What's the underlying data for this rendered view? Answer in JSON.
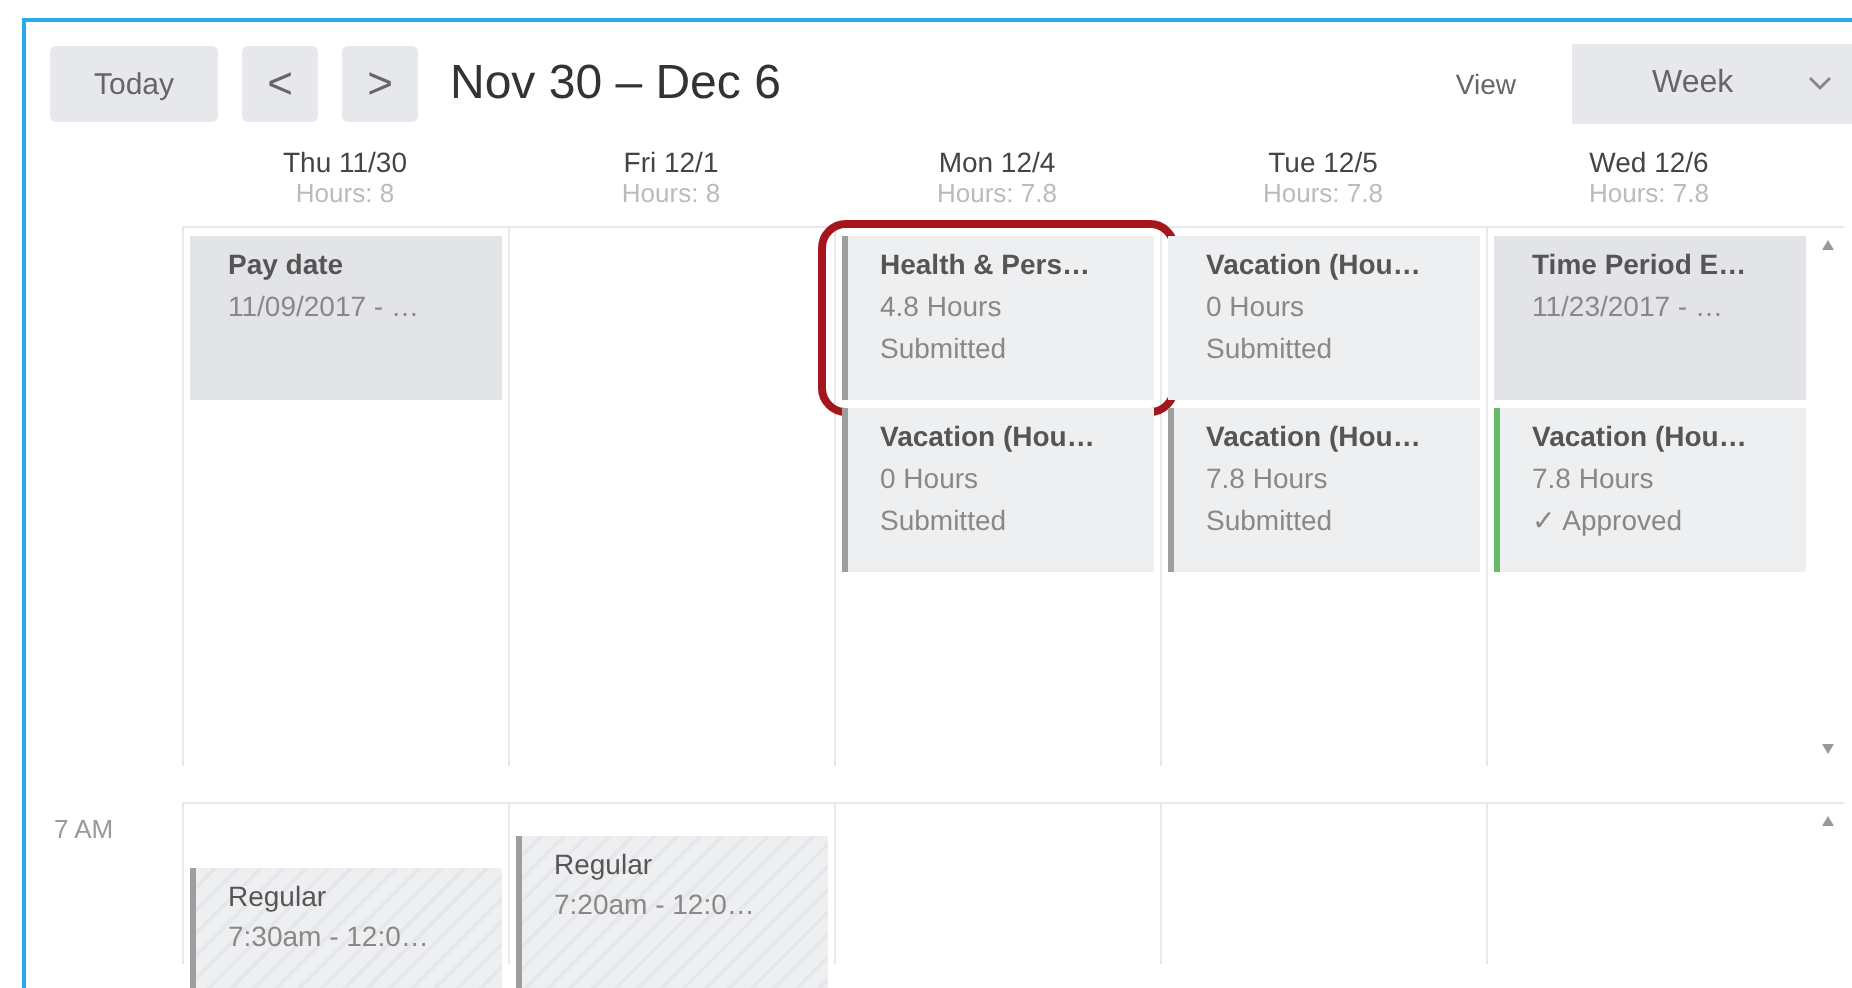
{
  "toolbar": {
    "today": "Today",
    "prev": "<",
    "next": ">",
    "range": "Nov 30 – Dec 6",
    "view_label": "View",
    "view_value": "Week"
  },
  "days": [
    {
      "name": "Thu 11/30",
      "hours": "Hours: 8",
      "entries": [
        {
          "kind": "info",
          "title": "Pay date",
          "lines": [
            "11/09/2017 - …"
          ],
          "highlighted": false
        }
      ],
      "timed": [
        {
          "title": "Regular",
          "lines": [
            "7:30am - 12:0…"
          ]
        }
      ]
    },
    {
      "name": "Fri 12/1",
      "hours": "Hours: 8",
      "timed": [
        {
          "title": "Regular",
          "lines": [
            "7:20am - 12:0…"
          ]
        }
      ]
    },
    {
      "name": "Mon 12/4",
      "hours": "Hours: 7.8",
      "entries": [
        {
          "kind": "request",
          "title": "Health & Pers…",
          "lines": [
            "4.8 Hours",
            "Submitted"
          ],
          "color": "#9e9e9e",
          "highlighted": true
        },
        {
          "kind": "request",
          "title": "Vacation (Hou…",
          "lines": [
            "0 Hours",
            "Submitted"
          ],
          "color": "#9e9e9e",
          "highlighted": false
        }
      ]
    },
    {
      "name": "Tue 12/5",
      "hours": "Hours: 7.8",
      "entries": [
        {
          "kind": "request",
          "title": "Vacation (Hou…",
          "lines": [
            "0 Hours",
            "Submitted"
          ],
          "color": "#eeeff1",
          "highlighted": false
        },
        {
          "kind": "request",
          "title": "Vacation (Hou…",
          "lines": [
            "7.8 Hours",
            "Submitted"
          ],
          "color": "#9e9e9e",
          "highlighted": false
        }
      ]
    },
    {
      "name": "Wed 12/6",
      "hours": "Hours: 7.8",
      "entries": [
        {
          "kind": "info",
          "title": "Time Period E…",
          "lines": [
            "11/23/2017 - …"
          ],
          "highlighted": false
        },
        {
          "kind": "request",
          "title": "Vacation (Hou…",
          "lines": [
            "7.8 Hours",
            "✓ Approved"
          ],
          "color": "#66bb6a",
          "highlighted": false
        }
      ]
    }
  ],
  "time_labels": [
    "7 AM"
  ]
}
